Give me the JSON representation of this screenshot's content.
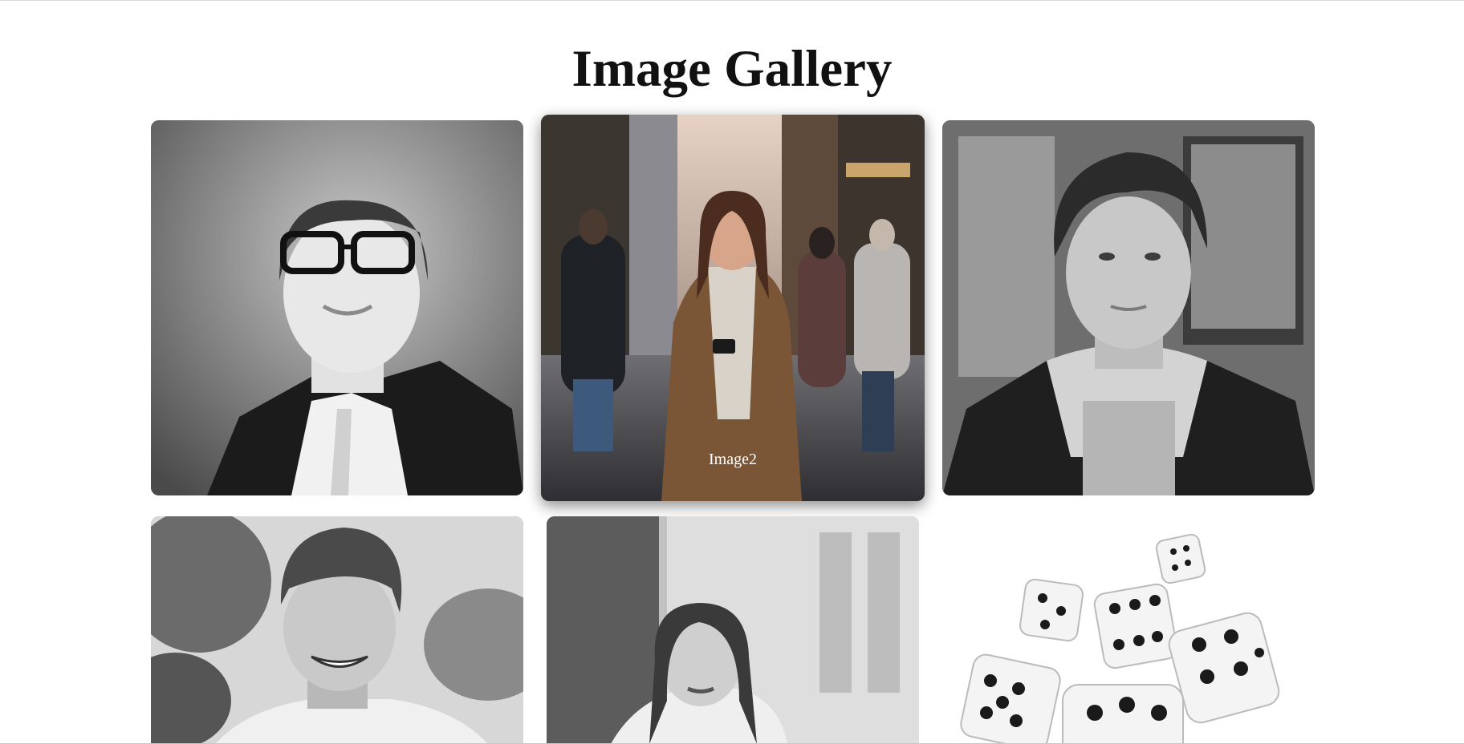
{
  "page": {
    "title": "Image Gallery"
  },
  "gallery": {
    "items": [
      {
        "caption": "",
        "icon": "man-glasses-suit-photo"
      },
      {
        "caption": "Image2",
        "icon": "woman-phone-street-photo"
      },
      {
        "caption": "",
        "icon": "young-man-hoodie-photo"
      },
      {
        "caption": "",
        "icon": "smiling-man-beanie-photo"
      },
      {
        "caption": "",
        "icon": "woman-street-photo"
      },
      {
        "caption": "",
        "icon": "dice-photo"
      }
    ]
  }
}
